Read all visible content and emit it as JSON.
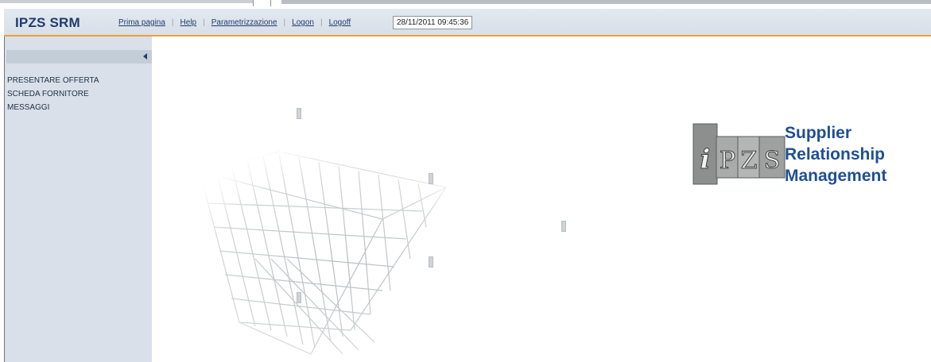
{
  "app": {
    "title": "IPZS SRM"
  },
  "nav": {
    "items": [
      {
        "label": "Prima pagina"
      },
      {
        "label": "Help"
      },
      {
        "label": "Parametrizzazione"
      },
      {
        "label": "Logon"
      },
      {
        "label": "Logoff"
      }
    ],
    "datetime": "28/11/2011 09:45:36"
  },
  "sidebar": {
    "collapse_icon": "triangle-left-icon",
    "items": [
      {
        "label": "PRESENTARE OFFERTA"
      },
      {
        "label": "SCHEDA FORNITORE",
        "highlighted": true
      },
      {
        "label": "MESSAGGI"
      }
    ]
  },
  "logo": {
    "tile_text": "iPZS",
    "lines": [
      "Supplier",
      "Relationship",
      "Management"
    ]
  },
  "colors": {
    "brand_blue": "#1f4f94",
    "header_bg": "#dde4ec",
    "sidebar_bg": "#d9e0e9",
    "highlight_red": "#e0001a",
    "accent_orange": "#f0a030"
  }
}
